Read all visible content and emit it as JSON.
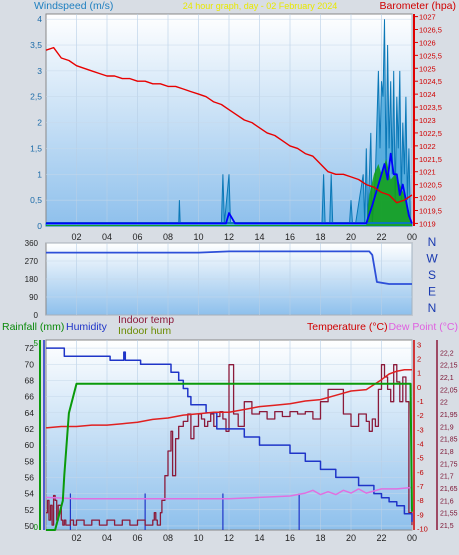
{
  "window": {
    "title": "24 hour graph, day - 02 February 2024"
  },
  "colors": {
    "background": "#d8dde4",
    "plot_top": "#ffffff",
    "plot_bottom": "#8ec0ec",
    "wind": "#0b78b7",
    "wind_avg": "#0000ff",
    "barometer": "#e80000",
    "direction": "#2d4fd8",
    "rain": "#0a9a0a",
    "humidity": "#1f35c8",
    "indoor_temp": "#8b1a3a",
    "indoor_hum": "#6b8b00",
    "temperature": "#e02020",
    "dew_point": "#e070e0",
    "title": "#e8e800"
  },
  "chart_data": [
    {
      "id": "wind-barometer",
      "type": "line",
      "title": "24 hour graph, day - 02 February 2024",
      "left_label": "Windspeed (m/s)",
      "right_label": "Barometer (hpa)",
      "x_ticks": [
        "02",
        "04",
        "06",
        "08",
        "10",
        "12",
        "14",
        "16",
        "18",
        "20",
        "22",
        "00"
      ],
      "left_ticks": [
        "0",
        "0,5",
        "1",
        "1,5",
        "2",
        "2,5",
        "3",
        "3,5",
        "4"
      ],
      "right_ticks": [
        "1019",
        "1019,5",
        "1020",
        "1020,5",
        "1021",
        "1021,5",
        "1022",
        "1022,5",
        "1023",
        "1023,5",
        "1024",
        "1024,5",
        "1025",
        "1025,5",
        "1026",
        "1026,5",
        "1027"
      ],
      "xlim": [
        0,
        24
      ],
      "ylim_left": [
        0,
        4.1
      ],
      "ylim_right": [
        1018.9,
        1027.1
      ],
      "series": [
        {
          "name": "Barometer",
          "axis": "right",
          "x": [
            0,
            0.5,
            1,
            1.5,
            2,
            2.5,
            3,
            3.5,
            4,
            4.5,
            5,
            5.5,
            6,
            6.5,
            7,
            7.5,
            8,
            8.5,
            9,
            9.5,
            10,
            10.5,
            11,
            11.5,
            12,
            12.5,
            13,
            13.5,
            14,
            14.5,
            15,
            15.5,
            16,
            16.5,
            17,
            17.5,
            18,
            18.5,
            19,
            19.5,
            20,
            20.5,
            21,
            21.5,
            22,
            22.5,
            23,
            23.5,
            24
          ],
          "values": [
            1025.7,
            1025.8,
            1025.4,
            1025.3,
            1025.1,
            1025.0,
            1024.9,
            1024.8,
            1024.7,
            1024.7,
            1024.6,
            1024.6,
            1024.5,
            1024.5,
            1024.4,
            1024.4,
            1024.3,
            1024.3,
            1024.2,
            1024.1,
            1024.0,
            1023.9,
            1023.7,
            1023.6,
            1023.4,
            1023.2,
            1023.0,
            1022.9,
            1022.7,
            1022.5,
            1022.4,
            1022.2,
            1022.0,
            1021.9,
            1021.7,
            1021.6,
            1021.3,
            1021.0,
            1020.9,
            1020.9,
            1020.8,
            1020.7,
            1020.5,
            1020.4,
            1020.2,
            1020.1,
            1019.8,
            1019.9,
            1020.1
          ]
        },
        {
          "name": "Windspeed",
          "axis": "left",
          "x": [
            0,
            8.7,
            8.75,
            8.8,
            11.5,
            11.6,
            11.7,
            12.0,
            12.1,
            18.1,
            18.2,
            18.3,
            18.6,
            18.7,
            18.8,
            19.9,
            20.0,
            20.1,
            20.2,
            20.3,
            20.8,
            20.9,
            21.0,
            21.1,
            21.3,
            21.4,
            21.6,
            21.8,
            21.9,
            22.0,
            22.1,
            22.2,
            22.3,
            22.4,
            22.5,
            22.6,
            22.7,
            22.8,
            22.9,
            23.0,
            23.1,
            23.2,
            23.3,
            23.4,
            23.5,
            23.6,
            23.7,
            23.8,
            23.9,
            24
          ],
          "values": [
            0.05,
            0.05,
            0.5,
            0.05,
            0.05,
            1.0,
            0.05,
            1.0,
            0.05,
            0.05,
            1.0,
            0.05,
            0.05,
            1.0,
            0.05,
            0.05,
            0.5,
            0.05,
            0.05,
            0.05,
            1.0,
            0.05,
            1.5,
            0.05,
            1.8,
            0.05,
            1.0,
            3.0,
            1.5,
            2.8,
            2.5,
            4.0,
            1.0,
            3.5,
            1.5,
            2.8,
            1.0,
            3.0,
            0.5,
            2.5,
            1.5,
            3.0,
            0.5,
            2.0,
            1.0,
            2.5,
            0.5,
            1.5,
            0.05,
            0.05
          ]
        },
        {
          "name": "Wind average",
          "axis": "left",
          "x": [
            0,
            11.8,
            12.0,
            12.2,
            12.4,
            21.0,
            21.4,
            21.8,
            22.0,
            22.2,
            22.4,
            22.6,
            22.8,
            23.0,
            23.2,
            23.4,
            23.6,
            23.8,
            24
          ],
          "values": [
            0.05,
            0.05,
            0.25,
            0.15,
            0.05,
            0.05,
            0.4,
            0.8,
            1.0,
            1.2,
            0.9,
            1.4,
            1.0,
            1.0,
            0.6,
            0.8,
            0.5,
            0.2,
            0.05
          ]
        },
        {
          "name": "Gust fill",
          "axis": "left",
          "x": [
            0,
            21.0,
            21.2,
            21.5,
            21.8,
            22.0,
            22.3,
            22.6,
            22.9,
            23.2,
            23.5,
            23.8,
            24
          ],
          "values": [
            0.02,
            0.02,
            0.6,
            1.0,
            1.2,
            1.0,
            1.3,
            0.9,
            1.0,
            0.8,
            0.6,
            0.3,
            0.02
          ]
        }
      ]
    },
    {
      "id": "direction",
      "type": "line",
      "right_ticks": [
        "N",
        "W",
        "S",
        "E",
        "N"
      ],
      "left_ticks": [
        "0",
        "90",
        "180",
        "270",
        "360"
      ],
      "ylim": [
        0,
        360
      ],
      "series": [
        {
          "name": "Wind direction",
          "x": [
            0,
            10,
            12,
            20,
            21.2,
            21.4,
            21.7,
            22.5,
            24
          ],
          "values": [
            312,
            312,
            318,
            318,
            318,
            300,
            165,
            155,
            155
          ]
        }
      ]
    },
    {
      "id": "temperature-humidity",
      "type": "line",
      "labels": {
        "rainfall": "Rainfall (mm)",
        "humidity": "Humidity",
        "indoor_temp": "Indoor temp",
        "indoor_hum": "Indoor hum",
        "temperature": "Temperature (°C)",
        "dew_point": "Dew Point (°C)"
      },
      "left_ticks": [
        "50",
        "52",
        "54",
        "56",
        "58",
        "60",
        "62",
        "64",
        "66",
        "68",
        "70",
        "72"
      ],
      "left_ylim": [
        49.5,
        73
      ],
      "right_ticks": [
        "-10",
        "-9",
        "-8",
        "-7",
        "-6",
        "-5",
        "-4",
        "-3",
        "-2",
        "-1",
        "0",
        "1",
        "2",
        "3"
      ],
      "right_ylim": [
        -10.1,
        3.3
      ],
      "far_right_ticks": [
        "21,5",
        "21,55",
        "21,6",
        "21,65",
        "21,7",
        "21,75",
        "21,8",
        "21,85",
        "21,9",
        "21,95",
        "22",
        "22,05",
        "22,1",
        "22,15",
        "22,2"
      ],
      "rain_tick": "5",
      "rain_tick_zero": "0",
      "series": [
        {
          "name": "Humidity",
          "axis": "left",
          "x": [
            0,
            1,
            1.2,
            4,
            4.2,
            5,
            5.1,
            5.2,
            6,
            6.2,
            7,
            7.1,
            8,
            8.2,
            8.5,
            8.7,
            9,
            9.3,
            9.5,
            10,
            10.5,
            11,
            11.2,
            12,
            13,
            14,
            15,
            16,
            17,
            17.5,
            18,
            18.5,
            19,
            19.5,
            20,
            20.5,
            21,
            21.5,
            22,
            22.5,
            23,
            23.5,
            24
          ],
          "values": [
            72,
            72,
            71,
            71,
            70.5,
            70.5,
            71.5,
            70.5,
            70.5,
            70,
            70,
            70,
            70,
            69,
            69,
            68,
            67,
            66,
            65,
            65,
            64,
            64,
            62,
            62,
            61,
            60,
            60,
            59,
            58,
            58,
            57,
            57,
            56,
            56,
            56,
            55,
            55,
            54,
            53.5,
            53,
            52.5,
            51.5,
            50.5
          ]
        },
        {
          "name": "Indoor temp",
          "axis": "far_right",
          "x": [
            0,
            0.1,
            0.2,
            0.3,
            0.4,
            0.5,
            0.6,
            0.7,
            0.8,
            1.0,
            1.1,
            1.2,
            1.3,
            1.6,
            1.8,
            2.0,
            2.5,
            3,
            3.5,
            4,
            4.5,
            5,
            5.5,
            6,
            6.5,
            7,
            7.1,
            7.2,
            7.3,
            7.5,
            7.6,
            7.8,
            8.0,
            8.2,
            8.3,
            8.5,
            8.7,
            9.0,
            9.3,
            9.5,
            9.7,
            10.0,
            10.2,
            10.4,
            10.6,
            10.8,
            11.0,
            11.2,
            11.4,
            11.6,
            11.8,
            12.0,
            12.3,
            12.6,
            13.0,
            13.5,
            14.0,
            14.5,
            15.0,
            15.5,
            16.0,
            16.5,
            17.0,
            17.5,
            18.0,
            18.5,
            19.0,
            19.5,
            20.0,
            20.5,
            21.0,
            21.2,
            21.4,
            21.6,
            21.8,
            22.0,
            22.2,
            22.4,
            22.6,
            22.8,
            23.0,
            23.2,
            23.4,
            23.6,
            23.8,
            24
          ],
          "values": [
            21.55,
            21.6,
            21.52,
            21.58,
            21.5,
            21.62,
            21.6,
            21.52,
            21.58,
            21.52,
            21.5,
            21.52,
            21.5,
            21.52,
            21.5,
            21.52,
            21.5,
            21.52,
            21.5,
            21.52,
            21.5,
            21.52,
            21.5,
            21.52,
            21.5,
            21.52,
            21.55,
            21.52,
            21.5,
            21.55,
            21.6,
            21.7,
            21.8,
            21.88,
            21.7,
            21.85,
            21.9,
            21.92,
            21.95,
            21.85,
            21.9,
            21.95,
            21.93,
            21.9,
            21.92,
            21.95,
            21.9,
            21.94,
            21.96,
            21.93,
            21.88,
            22.15,
            21.95,
            21.9,
            22.0,
            21.95,
            21.96,
            21.93,
            21.96,
            21.94,
            21.96,
            21.95,
            21.96,
            21.93,
            22.0,
            22.05,
            22.05,
            21.95,
            21.9,
            21.95,
            21.92,
            21.88,
            21.93,
            21.9,
            22.05,
            22.15,
            22.1,
            22.05,
            22.0,
            22.15,
            22.08,
            22.0,
            22.1,
            22.0,
            21.55,
            21.5
          ]
        },
        {
          "name": "Temperature",
          "axis": "right",
          "x": [
            0,
            1,
            2,
            3,
            4,
            5,
            6,
            7,
            8,
            9,
            10,
            11,
            12,
            13,
            14,
            15,
            16,
            17,
            18,
            19,
            20,
            21,
            22,
            22.5,
            23,
            23.5,
            24
          ],
          "values": [
            -2.9,
            -2.8,
            -2.8,
            -2.7,
            -2.7,
            -2.6,
            -2.5,
            -2.3,
            -2.2,
            -2.0,
            -1.9,
            -1.8,
            -1.8,
            -1.6,
            -1.4,
            -1.3,
            -1.2,
            -1.0,
            -0.9,
            -0.6,
            -0.3,
            -0.2,
            0.5,
            0.9,
            1.1,
            1.2,
            1.2
          ]
        },
        {
          "name": "Dew Point",
          "axis": "right",
          "x": [
            0,
            2,
            4,
            6,
            8,
            10,
            12,
            14,
            16,
            17,
            17.5,
            18,
            18.5,
            19,
            19.5,
            20,
            20.5,
            21,
            22,
            23,
            24
          ],
          "values": [
            -7.8,
            -7.9,
            -7.9,
            -7.9,
            -7.9,
            -7.9,
            -7.9,
            -7.8,
            -7.7,
            -7.5,
            -7.3,
            -7.6,
            -7.4,
            -7.6,
            -7.3,
            -7.5,
            -7.2,
            -7.5,
            -7.2,
            -7.2,
            -7.1
          ]
        },
        {
          "name": "Rainfall",
          "axis": "rain",
          "x": [
            0,
            0.6,
            1.1,
            1.2,
            1.5,
            2.0,
            23.9,
            24
          ],
          "values": [
            0,
            0,
            0.8,
            1.5,
            3.2,
            4.0,
            4.0,
            0.5
          ]
        },
        {
          "name": "Rain rate",
          "axis": "rain",
          "x": [
            1.6,
            1.6,
            6.5,
            6.5,
            11.6,
            11.6,
            16.6,
            16.6
          ],
          "values": [
            0,
            1.0,
            0,
            1.0,
            0,
            1.0,
            0,
            1.0
          ]
        }
      ]
    }
  ]
}
